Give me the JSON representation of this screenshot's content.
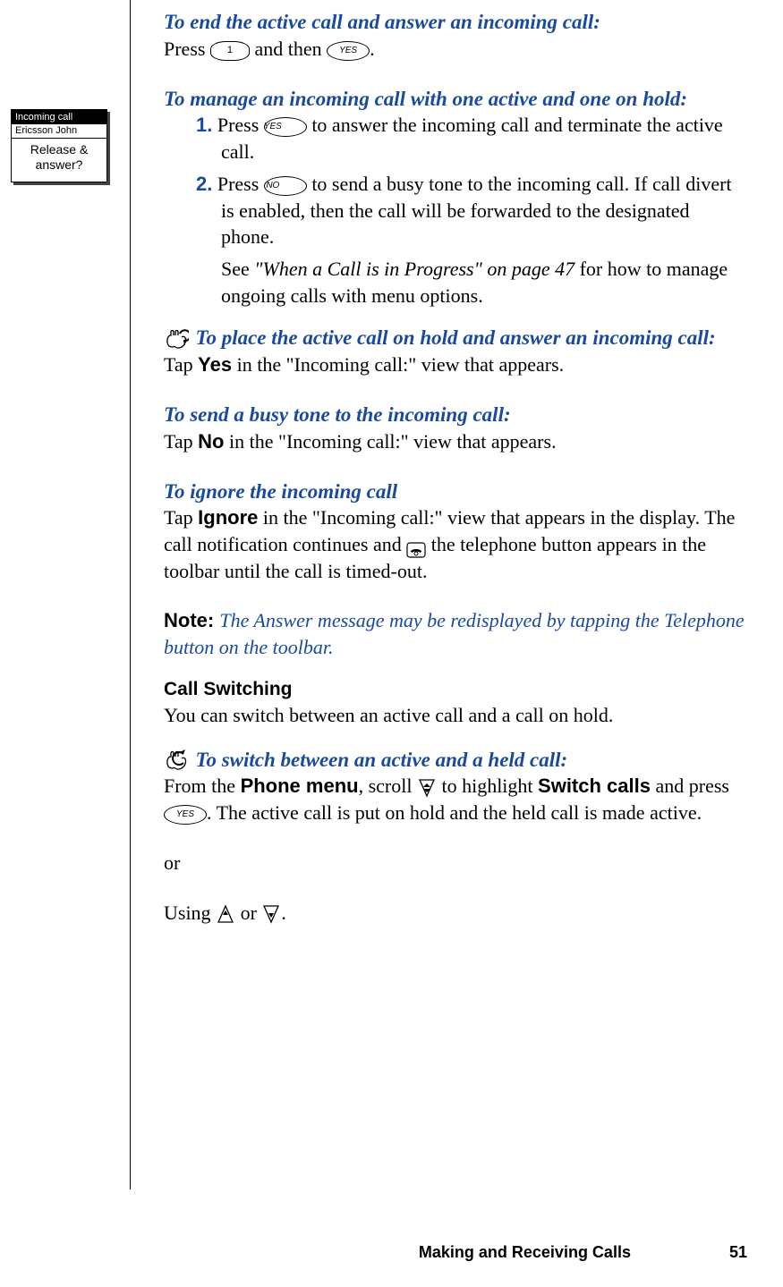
{
  "side_screen": {
    "header": "Incoming call",
    "name": "Ericsson John",
    "prompt_line1": "Release &",
    "prompt_line2": "answer?"
  },
  "buttons": {
    "one": "1",
    "yes": "YES",
    "no": "NO"
  },
  "arrows": {
    "up": "▲",
    "down": "▼"
  },
  "sections": {
    "s1": {
      "heading": "To end the active call and answer an incoming call:",
      "text_a": "Press ",
      "text_b": " and then ",
      "text_c": "."
    },
    "s2": {
      "heading": "To manage an incoming call with one active and one on hold:",
      "item1_num": "1.",
      "item1_a": " Press ",
      "item1_b": " to answer the incoming call and terminate the active call.",
      "item2_num": "2.",
      "item2_a": " Press ",
      "item2_b": " to send a busy tone to the incoming call. If call divert is enabled, then the call will be forwarded to the designated phone.",
      "see_a": "See ",
      "see_ref": "\"When a Call is in Progress\" on page 47",
      "see_b": " for how to manage ongoing calls with menu options."
    },
    "s3": {
      "heading": "To place the active call on hold and answer an incoming call:",
      "text_a": "Tap ",
      "yes_bold": "Yes",
      "text_b": " in the \"Incoming call:\" view that appears."
    },
    "s4": {
      "heading": "To send a busy tone to the incoming call:",
      "text_a": "Tap ",
      "no_bold": "No",
      "text_b": " in the \"Incoming call:\" view that appears."
    },
    "s5": {
      "heading": "To ignore the incoming call",
      "text_a": "Tap ",
      "ignore_bold": "Ignore",
      "text_b": " in the \"Incoming call:\" view that appears in the display. The call notification continues and ",
      "text_c": " the telephone button appears in the toolbar until the call is timed-out."
    },
    "note": {
      "label": "Note:  ",
      "text": "The Answer message may be redisplayed by tapping the Telephone button on the toolbar."
    },
    "s6": {
      "heading": "Call Switching",
      "text": "You can switch between an active call and a call on hold."
    },
    "s7": {
      "heading": "To switch between an active and a held call:",
      "text_a": "From the ",
      "phone_menu": "Phone menu",
      "text_b": ", scroll ",
      "text_c": " to highlight ",
      "switch_calls": "Switch calls",
      "text_d": " and press ",
      "text_e": ". The active call is put on hold and the held call is made active."
    },
    "or": "or",
    "s8": {
      "text_a": "Using ",
      "text_b": " or ",
      "text_c": "."
    }
  },
  "footer": {
    "title": "Making and Receiving Calls",
    "page": "51"
  }
}
